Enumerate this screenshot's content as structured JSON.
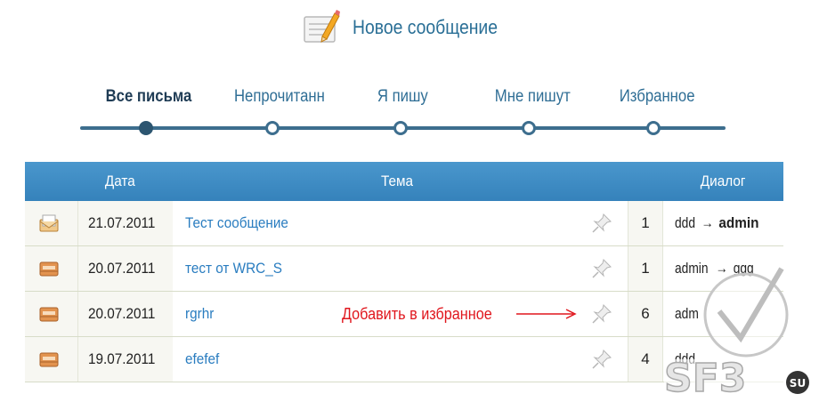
{
  "compose": {
    "label": "Новое сообщение",
    "icon": "compose-pencil-icon"
  },
  "tabs": [
    {
      "label": "Все письма",
      "active": true
    },
    {
      "label": "Непрочитанн",
      "active": false
    },
    {
      "label": "Я пишу",
      "active": false
    },
    {
      "label": "Мне пишут",
      "active": false
    },
    {
      "label": "Избранное",
      "active": false
    }
  ],
  "table": {
    "headers": {
      "date": "Дата",
      "subject": "Тема",
      "dialog": "Диалог"
    },
    "rows": [
      {
        "icon": "envelope-open-icon",
        "date": "21.07.2011",
        "subject": "Тест сообщение",
        "count": "1",
        "from": "ddd",
        "arrow": "→",
        "to": "admin",
        "to_bold": true
      },
      {
        "icon": "envelope-closed-icon",
        "date": "20.07.2011",
        "subject": "тест от WRC_S",
        "count": "1",
        "from": "admin",
        "arrow": "→",
        "to": "ggg",
        "to_bold": false
      },
      {
        "icon": "envelope-closed-icon",
        "date": "20.07.2011",
        "subject": "rgrhr",
        "count": "6",
        "from": "adm",
        "arrow": "",
        "to": "",
        "to_bold": false
      },
      {
        "icon": "envelope-closed-icon",
        "date": "19.07.2011",
        "subject": "efefef",
        "count": "4",
        "from": "ddd",
        "arrow": "",
        "to": "",
        "to_bold": false
      }
    ]
  },
  "annotation": {
    "text": "Добавить в избранное"
  },
  "watermark": {
    "text": "SF3",
    "suffix": "SU"
  },
  "colors": {
    "header_blue": "#3a89c3",
    "link_blue": "#2a7dc0",
    "annotation_red": "#e0161d",
    "track": "#3d6e8e"
  }
}
